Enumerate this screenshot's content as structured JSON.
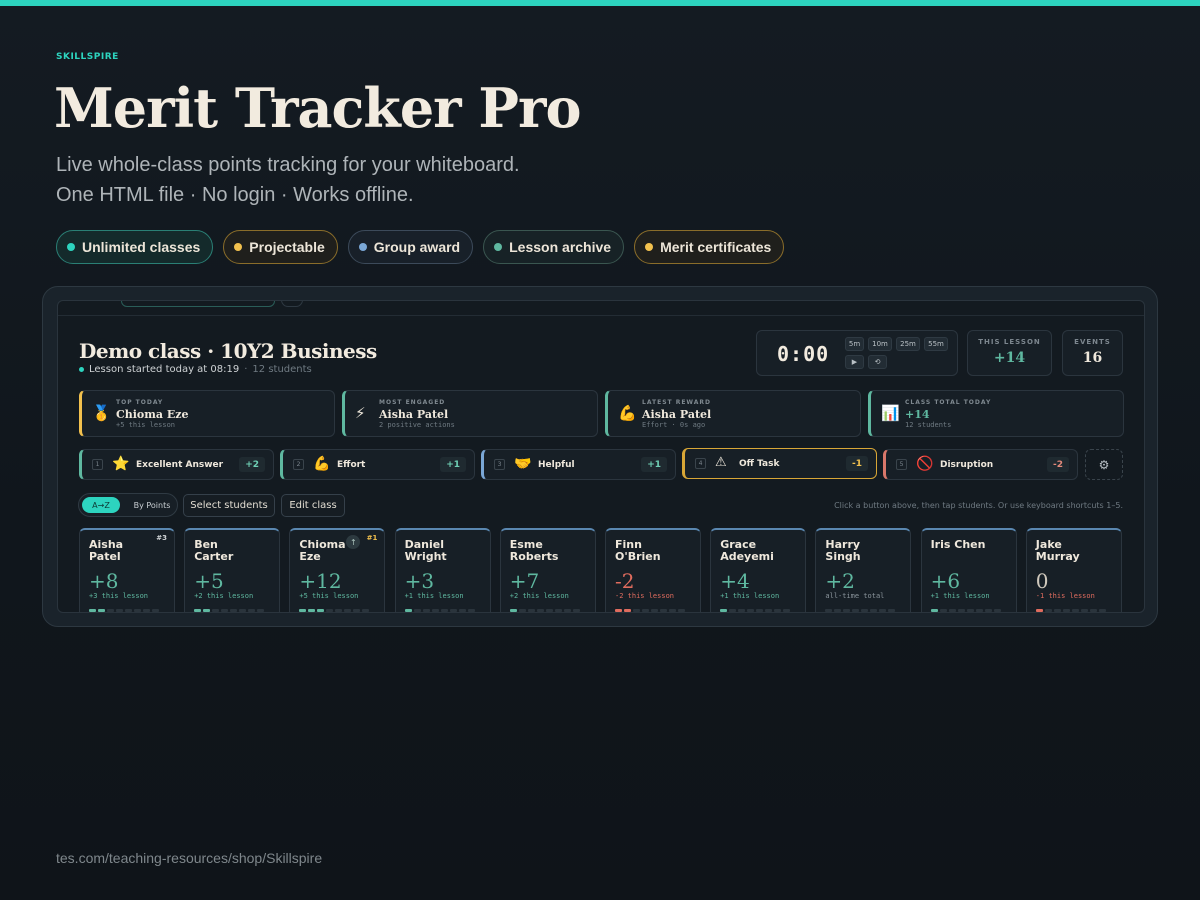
{
  "brand": "SKILLSPIRE",
  "title": "Merit Tracker Pro",
  "subtitle_line1": "Live whole-class points tracking for your whiteboard.",
  "subtitle_line2": "One HTML file · No login · Works offline.",
  "pills": [
    {
      "label": "Unlimited classes",
      "color": "#2dd4bf"
    },
    {
      "label": "Projectable",
      "color": "#f2c14e"
    },
    {
      "label": "Group award",
      "color": "#7aa7d6"
    },
    {
      "label": "Lesson archive",
      "color": "#5fb8a0"
    },
    {
      "label": "Merit certificates",
      "color": "#f2c14e"
    }
  ],
  "app": {
    "class_title": "Demo class · 10Y2 Business",
    "lesson_started": "Lesson started today at 08:19",
    "separator": "·",
    "student_count": "12 students",
    "timer": {
      "value": "0:00",
      "presets": [
        "5m",
        "10m",
        "25m",
        "55m"
      ],
      "play_icon": "▶",
      "reset_icon": "⟲"
    },
    "stats": [
      {
        "label": "THIS LESSON",
        "value": "+14",
        "color": "#5fb8a0"
      },
      {
        "label": "EVENTS",
        "value": "16",
        "color": "#efe8dc"
      }
    ],
    "cards": [
      {
        "label": "TOP TODAY",
        "name": "Chioma Eze",
        "detail": "+5 this lesson",
        "icon": "🥇",
        "accent": "#f2c14e"
      },
      {
        "label": "MOST ENGAGED",
        "name": "Aisha Patel",
        "detail": "2 positive actions",
        "icon": "⚡",
        "accent": "#5fb8a0"
      },
      {
        "label": "LATEST REWARD",
        "name": "Aisha Patel",
        "detail": "Effort · 0s ago",
        "icon": "💪",
        "accent": "#5fb8a0"
      },
      {
        "label": "CLASS TOTAL TODAY",
        "name": "+14",
        "detail": "12 students",
        "icon": "📊",
        "accent": "#5fb8a0"
      }
    ],
    "actions": [
      {
        "key": "1",
        "icon": "⭐",
        "label": "Excellent Answer",
        "points": "+2",
        "accent": "#5fb8a0",
        "pts_color": "#6fd0b5"
      },
      {
        "key": "2",
        "icon": "💪",
        "label": "Effort",
        "points": "+1",
        "accent": "#5fb8a0",
        "pts_color": "#6fd0b5"
      },
      {
        "key": "3",
        "icon": "🤝",
        "label": "Helpful",
        "points": "+1",
        "accent": "#7aa7d6",
        "pts_color": "#6fd0b5"
      },
      {
        "key": "4",
        "icon": "⚠",
        "label": "Off Task",
        "points": "-1",
        "accent": "#d8a636",
        "pts_color": "#f2c14e"
      },
      {
        "key": "5",
        "icon": "🚫",
        "label": "Disruption",
        "points": "-2",
        "accent": "#d9776a",
        "pts_color": "#e58a7b"
      }
    ],
    "gear_icon": "⚙",
    "sort": {
      "active": "A→Z",
      "inactive": "By Points"
    },
    "select_students": "Select students",
    "edit_class": "Edit class",
    "hint": "Click a button above, then tap students. Or use keyboard shortcuts 1–5.",
    "students": [
      {
        "first": "Aisha",
        "last": "Patel",
        "points": "+8",
        "lesson": "+3 this lesson",
        "color": "#5fb8a0",
        "rank": "#3",
        "up": "",
        "bars": 2,
        "bar_color": "#5fb8a0"
      },
      {
        "first": "Ben",
        "last": "Carter",
        "points": "+5",
        "lesson": "+2 this lesson",
        "color": "#5fb8a0",
        "rank": "",
        "up": "",
        "bars": 2,
        "bar_color": "#5fb8a0"
      },
      {
        "first": "Chioma",
        "last": "Eze",
        "points": "+12",
        "lesson": "+5 this lesson",
        "color": "#5fb8a0",
        "rank": "#1",
        "up": "↑",
        "bars": 3,
        "bar_color": "#5fb8a0"
      },
      {
        "first": "Daniel",
        "last": "Wright",
        "points": "+3",
        "lesson": "+1 this lesson",
        "color": "#5fb8a0",
        "rank": "",
        "up": "",
        "bars": 1,
        "bar_color": "#5fb8a0"
      },
      {
        "first": "Esme",
        "last": "Roberts",
        "points": "+7",
        "lesson": "+2 this lesson",
        "color": "#5fb8a0",
        "rank": "",
        "up": "",
        "bars": 1,
        "bar_color": "#5fb8a0"
      },
      {
        "first": "Finn",
        "last": "O'Brien",
        "points": "-2",
        "lesson": "-2 this lesson",
        "color": "#e06c5e",
        "rank": "",
        "up": "",
        "bars": 2,
        "bar_color": "#e06c5e"
      },
      {
        "first": "Grace",
        "last": "Adeyemi",
        "points": "+4",
        "lesson": "+1 this lesson",
        "color": "#5fb8a0",
        "rank": "",
        "up": "",
        "bars": 1,
        "bar_color": "#5fb8a0"
      },
      {
        "first": "Harry",
        "last": "Singh",
        "points": "+2",
        "lesson": "all-time total",
        "color": "#5fb8a0",
        "rank": "",
        "up": "",
        "bars": 0,
        "bar_color": "#5fb8a0",
        "lesson_color": "#8a949b"
      },
      {
        "first": "Iris Chen",
        "last": "",
        "points": "+6",
        "lesson": "+1 this lesson",
        "color": "#5fb8a0",
        "rank": "",
        "up": "",
        "bars": 1,
        "bar_color": "#5fb8a0"
      },
      {
        "first": "Jake",
        "last": "Murray",
        "points": "0",
        "lesson": "-1 this lesson",
        "color": "#cfc8bc",
        "rank": "",
        "up": "",
        "bars": 1,
        "bar_color": "#e06c5e",
        "lesson_color": "#e06c5e"
      }
    ]
  },
  "footer": "tes.com/teaching-resources/shop/Skillspire"
}
